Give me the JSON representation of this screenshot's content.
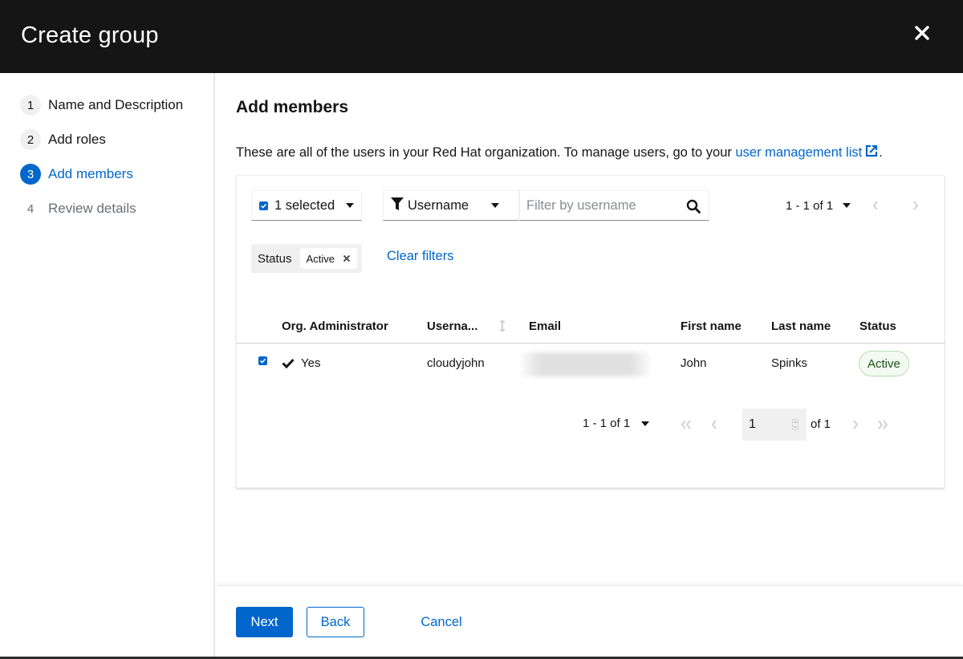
{
  "modal": {
    "title": "Create group",
    "close_icon": "close-icon"
  },
  "wizard_nav": {
    "steps": [
      {
        "number": "1",
        "label": "Name and Description",
        "state": "visited"
      },
      {
        "number": "2",
        "label": "Add roles",
        "state": "visited"
      },
      {
        "number": "3",
        "label": "Add members",
        "state": "current"
      },
      {
        "number": "4",
        "label": "Review details",
        "state": "disabled"
      }
    ]
  },
  "main": {
    "heading": "Add members",
    "description_prefix": "These are all of the users in your Red Hat organization. To manage users, go to your ",
    "description_link": "user management list",
    "description_suffix": ".",
    "link_icon": "external-link-icon"
  },
  "toolbar": {
    "bulk_select_label": "1 selected",
    "bulk_checked": true,
    "filter_attribute": "Username",
    "filter_icon": "filter-icon",
    "search_placeholder": "Filter by username",
    "search_value": "",
    "pagination_label": "1 - 1 of 1"
  },
  "active_filters": {
    "category": "Status",
    "chips": [
      "Active"
    ],
    "clear_label": "Clear filters"
  },
  "table": {
    "columns": [
      "Org. Administrator",
      "Userna...",
      "Email",
      "First name",
      "Last name",
      "Status"
    ],
    "rows": [
      {
        "selected": true,
        "org_admin": "Yes",
        "username": "cloudyjohn",
        "email": "",
        "first_name": "John",
        "last_name": "Spinks",
        "status": "Active"
      }
    ]
  },
  "pagination_bottom": {
    "range_label": "1 - 1 of 1",
    "current_page": "1",
    "of_label": "of 1"
  },
  "footer": {
    "next_label": "Next",
    "back_label": "Back",
    "cancel_label": "Cancel"
  },
  "colors": {
    "accent": "#0066cc",
    "header_bg": "#151515",
    "success_border": "#b7dfb0",
    "success_text": "#1e4f18"
  }
}
